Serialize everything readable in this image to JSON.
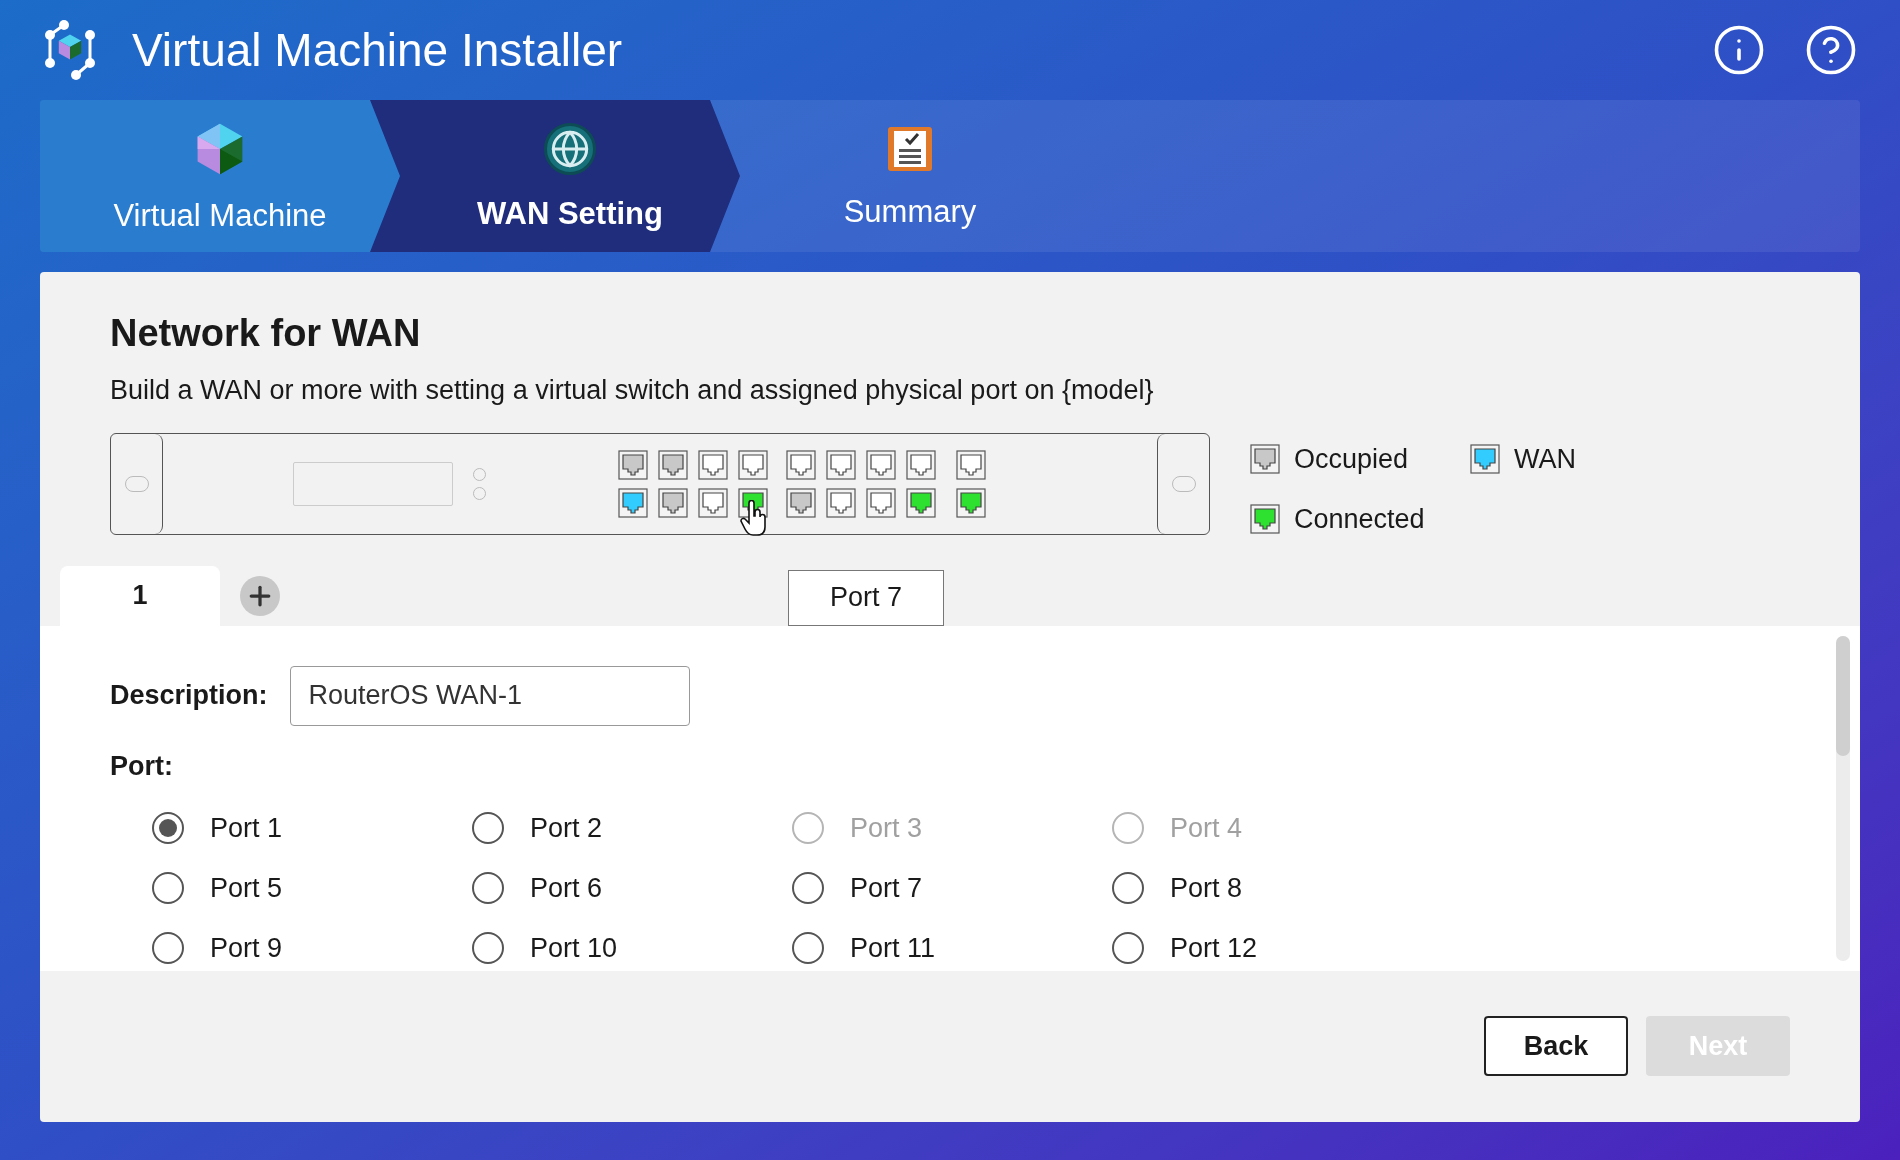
{
  "window": {
    "title": "Virtual Machine Installer"
  },
  "steps": [
    {
      "label": "Virtual Machine",
      "selected": false,
      "completed": true
    },
    {
      "label": "WAN Setting",
      "selected": true,
      "completed": false
    },
    {
      "label": "Summary",
      "selected": false,
      "completed": false
    }
  ],
  "section": {
    "heading": "Network for WAN",
    "description": "Build a WAN or more with setting a virtual switch and assigned physical port on {model}"
  },
  "switch": {
    "port_rows": [
      [
        {
          "kind": "occupied",
          "hovered": false
        },
        {
          "kind": "occupied",
          "hovered": false
        },
        {
          "kind": "free",
          "hovered": false
        },
        {
          "kind": "free",
          "hovered": false
        },
        {
          "kind": "free",
          "hovered": false
        },
        {
          "kind": "free",
          "hovered": false
        },
        {
          "kind": "free",
          "hovered": false
        },
        {
          "kind": "free",
          "hovered": false
        },
        {
          "kind": "free",
          "hovered": false
        }
      ],
      [
        {
          "kind": "wan",
          "hovered": false
        },
        {
          "kind": "occupied",
          "hovered": false
        },
        {
          "kind": "free",
          "hovered": false
        },
        {
          "kind": "connected",
          "hovered": true
        },
        {
          "kind": "occupied",
          "hovered": false
        },
        {
          "kind": "free",
          "hovered": false
        },
        {
          "kind": "free",
          "hovered": false
        },
        {
          "kind": "connected",
          "hovered": false
        },
        {
          "kind": "connected",
          "hovered": false
        }
      ]
    ],
    "tooltip": "Port 7"
  },
  "legend": [
    {
      "label": "Occupied",
      "kind": "occupied"
    },
    {
      "label": "WAN",
      "kind": "wan"
    },
    {
      "label": "Connected",
      "kind": "connected"
    }
  ],
  "wan_tabs": [
    {
      "label": "1",
      "selected": true
    }
  ],
  "form": {
    "description_label": "Description:",
    "description_value": "RouterOS WAN-1",
    "port_label": "Port:",
    "ports": [
      {
        "label": "Port 1",
        "selected": true,
        "disabled": false
      },
      {
        "label": "Port 2",
        "selected": false,
        "disabled": false
      },
      {
        "label": "Port 3",
        "selected": false,
        "disabled": true
      },
      {
        "label": "Port 4",
        "selected": false,
        "disabled": true
      },
      {
        "label": "Port 5",
        "selected": false,
        "disabled": false
      },
      {
        "label": "Port 6",
        "selected": false,
        "disabled": false
      },
      {
        "label": "Port 7",
        "selected": false,
        "disabled": false
      },
      {
        "label": "Port 8",
        "selected": false,
        "disabled": false
      },
      {
        "label": "Port 9",
        "selected": false,
        "disabled": false
      },
      {
        "label": "Port 10",
        "selected": false,
        "disabled": false
      },
      {
        "label": "Port 11",
        "selected": false,
        "disabled": false
      },
      {
        "label": "Port 12",
        "selected": false,
        "disabled": false
      }
    ]
  },
  "buttons": [
    {
      "label": "Back",
      "disabled": false
    },
    {
      "label": "Next",
      "disabled": true
    }
  ]
}
